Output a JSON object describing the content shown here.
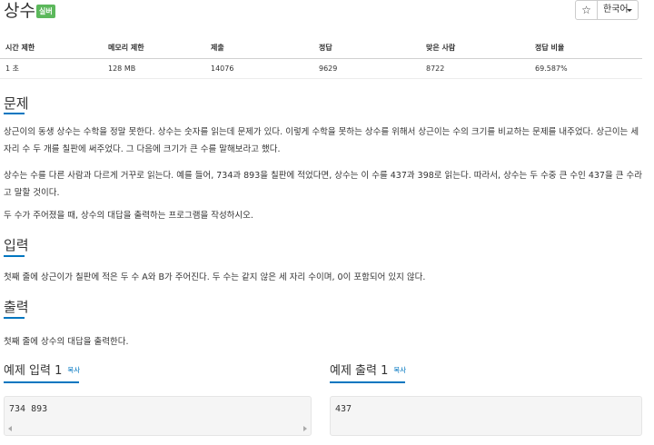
{
  "problem": {
    "title": "상수",
    "tier_badge": "실버",
    "tier_color": "#5cb85c"
  },
  "toolbar": {
    "star_label": "☆",
    "language_label": "한국어"
  },
  "stats": {
    "headers": [
      "시간 제한",
      "메모리 제한",
      "제출",
      "정답",
      "맞은 사람",
      "정답 비율"
    ],
    "values": [
      "1 초",
      "128 MB",
      "14076",
      "9629",
      "8722",
      "69.587%"
    ]
  },
  "sections": {
    "description": {
      "heading": "문제",
      "paragraphs": [
        "상근이의 동생 상수는 수학을 정말 못한다. 상수는 숫자를 읽는데 문제가 있다. 이렇게 수학을 못하는 상수를 위해서 상근이는 수의 크기를 비교하는 문제를 내주었다. 상근이는 세 자리 수 두 개를 칠판에 써주었다. 그 다음에 크기가 큰 수를 말해보라고 했다.",
        "상수는 수를 다른 사람과 다르게 거꾸로 읽는다. 예를 들어, 734과 893을 칠판에 적었다면, 상수는 이 수를 437과 398로 읽는다. 따라서, 상수는 두 수중 큰 수인 437을 큰 수라고 말할 것이다.",
        "두 수가 주어졌을 때, 상수의 대답을 출력하는 프로그램을 작성하시오."
      ]
    },
    "input": {
      "heading": "입력",
      "text": "첫째 줄에 상근이가 칠판에 적은 두 수 A와 B가 주어진다. 두 수는 같지 않은 세 자리 수이며, 0이 포함되어 있지 않다."
    },
    "output": {
      "heading": "출력",
      "text": "첫째 줄에 상수의 대답을 출력한다."
    }
  },
  "samples": {
    "input": {
      "title": "예제 입력 1",
      "copy_label": "복사",
      "content": "734 893"
    },
    "output": {
      "title": "예제 출력 1",
      "copy_label": "복사",
      "content": "437"
    }
  },
  "colors": {
    "accent": "#0076c0",
    "sample_bg": "#f5f5f5"
  }
}
